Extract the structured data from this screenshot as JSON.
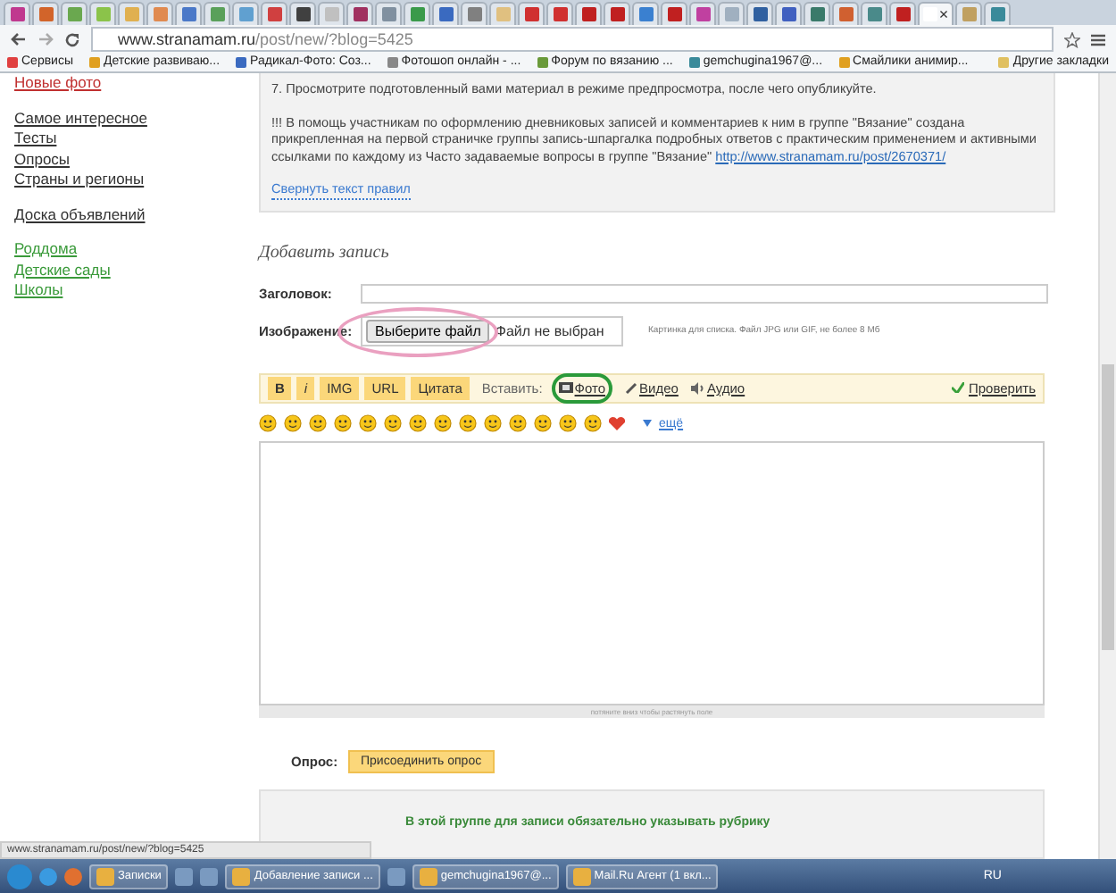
{
  "browser": {
    "tabs": [
      {
        "color": "#c0398f",
        "selected": false
      },
      {
        "color": "#d2642a",
        "selected": false
      },
      {
        "color": "#6aa84f",
        "selected": false
      },
      {
        "color": "#8bc34a",
        "selected": false
      },
      {
        "color": "#e0b050",
        "selected": false
      },
      {
        "color": "#e08a50",
        "selected": false
      },
      {
        "color": "#4a78c8",
        "selected": false
      },
      {
        "color": "#5aa05a",
        "selected": false
      },
      {
        "color": "#60a0d0",
        "selected": false
      },
      {
        "color": "#d04040",
        "selected": false
      },
      {
        "color": "#404040",
        "selected": false
      },
      {
        "color": "#c0c0c0",
        "selected": false
      },
      {
        "color": "#a03060",
        "selected": false
      },
      {
        "color": "#8090a0",
        "selected": false
      },
      {
        "color": "#3a9a4a",
        "selected": false
      },
      {
        "color": "#3a6ac0",
        "selected": false
      },
      {
        "color": "#808080",
        "selected": false
      },
      {
        "color": "#e0c080",
        "selected": false
      },
      {
        "color": "#d03030",
        "selected": false
      },
      {
        "color": "#d03030",
        "selected": false
      },
      {
        "color": "#c02020",
        "selected": false
      },
      {
        "color": "#c02020",
        "selected": false
      },
      {
        "color": "#3a80d0",
        "selected": false
      },
      {
        "color": "#c02020",
        "selected": false
      },
      {
        "color": "#c040a0",
        "selected": false
      },
      {
        "color": "#a0b0c0",
        "selected": false
      },
      {
        "color": "#3060a0",
        "selected": false
      },
      {
        "color": "#4060c0",
        "selected": false
      },
      {
        "color": "#3a7a6a",
        "selected": false
      },
      {
        "color": "#d06030",
        "selected": false
      },
      {
        "color": "#4a8a8a",
        "selected": false
      },
      {
        "color": "#c02020",
        "selected": false
      },
      {
        "color": "#ffffff",
        "selected": true
      },
      {
        "color": "#c0a060",
        "selected": false
      },
      {
        "color": "#3a8a9a",
        "selected": false
      }
    ],
    "close_tab": "×",
    "url_host": "www.stranamam.ru",
    "url_path": "/post/new/?blog=5425",
    "bookmarks": [
      "Сервисы",
      "Детские развиваю...",
      "Радикал-Фото: Соз...",
      "Фотошоп онлайн - ...",
      "Форум по вязанию ...",
      "gemchugina1967@...",
      "Смайлики анимир..."
    ],
    "other_bookmarks": "Другие закладки"
  },
  "sidebar": {
    "groups": [
      {
        "kind": "red",
        "items": [
          "Новые фото"
        ]
      },
      {
        "kind": "plain",
        "items": [
          "Самое интересное",
          "Тесты",
          "Опросы",
          "Страны и регионы"
        ]
      },
      {
        "kind": "plain",
        "items": [
          "Доска объявлений"
        ]
      },
      {
        "kind": "green",
        "items": [
          "Роддома",
          "Детские сады",
          "Школы"
        ]
      }
    ]
  },
  "rules": {
    "step": "7. Просмотрите подготовленный вами материал в режиме предпросмотра, после чего опубликуйте.",
    "note": "!!! В помощь участникам по оформлению дневниковых записей и комментариев к ним в группе \"Вязание\" создана прикрепленная на первой страничке группы запись-шпаргалка подробных ответов с практическим применением и активными ссылками по каждому из Часто задаваемые вопросы в группе \"Вязание\"",
    "link": "http://www.stranamam.ru/post/2670371/",
    "collapse": "Свернуть текст правил"
  },
  "form": {
    "heading": "Добавить запись",
    "title_label": "Заголовок:",
    "image_label": "Изображение:",
    "file_button": "Выберите файл",
    "file_status": "Файл не выбран",
    "image_hint": "Картинка для списка. Файл JPG или GIF, не более 8 Мб",
    "format_buttons": [
      "B",
      "i",
      "IMG",
      "URL",
      "Цитата"
    ],
    "insert_label": "Вставить:",
    "insert_links": [
      {
        "kind": "photo",
        "label": "Фото",
        "circled": true
      },
      {
        "kind": "video",
        "label": "Видео",
        "circled": false
      },
      {
        "kind": "audio",
        "label": "Аудио",
        "circled": false
      }
    ],
    "check": "Проверить",
    "smileys": [
      {
        "kind": "face"
      },
      {
        "kind": "face"
      },
      {
        "kind": "face"
      },
      {
        "kind": "face"
      },
      {
        "kind": "face"
      },
      {
        "kind": "face"
      },
      {
        "kind": "face"
      },
      {
        "kind": "face"
      },
      {
        "kind": "face"
      },
      {
        "kind": "face"
      },
      {
        "kind": "face"
      },
      {
        "kind": "face"
      },
      {
        "kind": "face"
      },
      {
        "kind": "face"
      },
      {
        "kind": "heart"
      }
    ],
    "more": "ещё",
    "resize_hint": "потяните вниз чтобы растянуть поле",
    "poll_label": "Опрос:",
    "poll_button": "Присоединить опрос",
    "rubric_note": "В этой группе для записи обязательно указывать рубрику"
  },
  "status_url": "www.stranamam.ru/post/new/?blog=5425",
  "taskbar": {
    "items": [
      {
        "kind": "start"
      },
      {
        "kind": "ie"
      },
      {
        "kind": "firefox"
      },
      {
        "kind": "window",
        "label": "Записки"
      },
      {
        "kind": "icon"
      },
      {
        "kind": "icon"
      },
      {
        "kind": "window",
        "label": "Добавление записи ..."
      },
      {
        "kind": "icon"
      },
      {
        "kind": "window",
        "label": "gemchugina1967@..."
      },
      {
        "kind": "window",
        "label": "Mail.Ru Агент (1 вкл..."
      }
    ],
    "language": "RU"
  }
}
